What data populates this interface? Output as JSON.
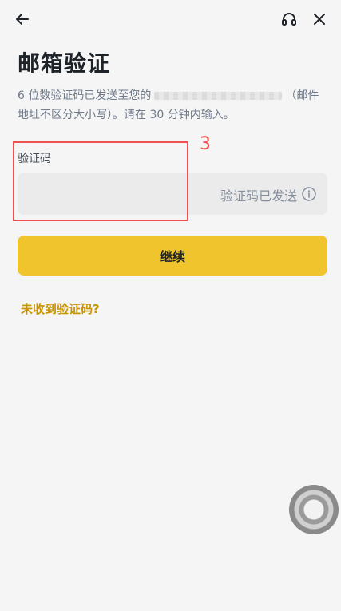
{
  "header": {
    "back_icon": "arrow-left-icon",
    "support_icon": "headset-icon",
    "close_icon": "close-icon"
  },
  "page": {
    "title": "邮箱验证",
    "description_prefix": "6 位数验证码已发送至您的",
    "description_suffix": "（邮件地址不区分大小写）。请在 30 分钟内输入。"
  },
  "form": {
    "code_label": "验证码",
    "code_value": "",
    "code_sent_text": "验证码已发送",
    "info_icon": "info-circle-icon"
  },
  "annotation": {
    "number": "3",
    "color": "#f05050"
  },
  "actions": {
    "continue_label": "继续",
    "resend_link": "未收到验证码?"
  },
  "colors": {
    "accent": "#f0c42c",
    "link": "#c99400",
    "background": "#f5f5f5"
  }
}
